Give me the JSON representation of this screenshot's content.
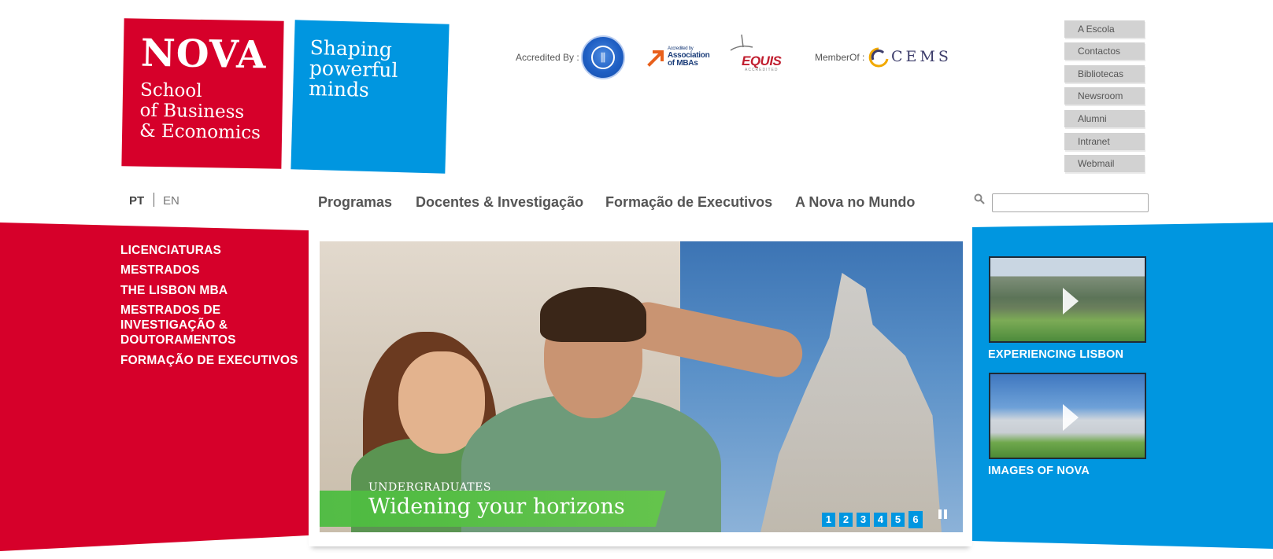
{
  "logo": {
    "name": "NOVA",
    "subtitle_lines": [
      "School",
      "of Business",
      "& Economics"
    ],
    "tagline_lines": [
      "Shaping",
      "powerful",
      "minds"
    ],
    "primary_color": "#d6002a",
    "secondary_color": "#0096e0"
  },
  "accreditation": {
    "accredited_label": "Accredited By :",
    "member_label": "MemberOf :",
    "logos": [
      {
        "icon": "aacsb-seal-icon"
      },
      {
        "icon": "amba-logo",
        "text_lines": [
          "Accredited by",
          "Association",
          "of MBAs"
        ]
      },
      {
        "icon": "equis-logo",
        "text": "EQUIS",
        "sub": "ACCREDITED"
      },
      {
        "icon": "cems-logo",
        "text": "CEMS"
      }
    ]
  },
  "utility_nav": [
    "A Escola",
    "Contactos",
    "Bibliotecas",
    "Newsroom",
    "Alumni",
    "Intranet",
    "Webmail"
  ],
  "language": {
    "pt": "PT",
    "en": "EN",
    "active": "PT"
  },
  "main_nav": [
    "Programas",
    "Docentes & Investigação",
    "Formação de Executivos",
    "A Nova no Mundo"
  ],
  "search": {
    "icon": "search-icon",
    "placeholder": "",
    "value": ""
  },
  "programs": {
    "links": [
      {
        "lines": [
          "LICENCIATURAS"
        ]
      },
      {
        "lines": [
          "MESTRADOS"
        ]
      },
      {
        "lines": [
          "THE LISBON MBA"
        ]
      },
      {
        "lines": [
          "MESTRADOS DE",
          "INVESTIGAÇÃO &",
          "DOUTORAMENTOS"
        ]
      },
      {
        "lines": [
          "FORMAÇÃO DE EXECUTIVOS"
        ]
      }
    ]
  },
  "hero": {
    "kicker": "UNDERGRADUATES",
    "title": "Widening your horizons",
    "pages": [
      "1",
      "2",
      "3",
      "4",
      "5",
      "6"
    ],
    "pause_icon": "pause-icon",
    "band_color": "#4cbc40"
  },
  "videos": [
    {
      "label": "EXPERIENCING LISBON",
      "icon": "play-icon"
    },
    {
      "label": "IMAGES OF NOVA",
      "icon": "play-icon"
    }
  ]
}
